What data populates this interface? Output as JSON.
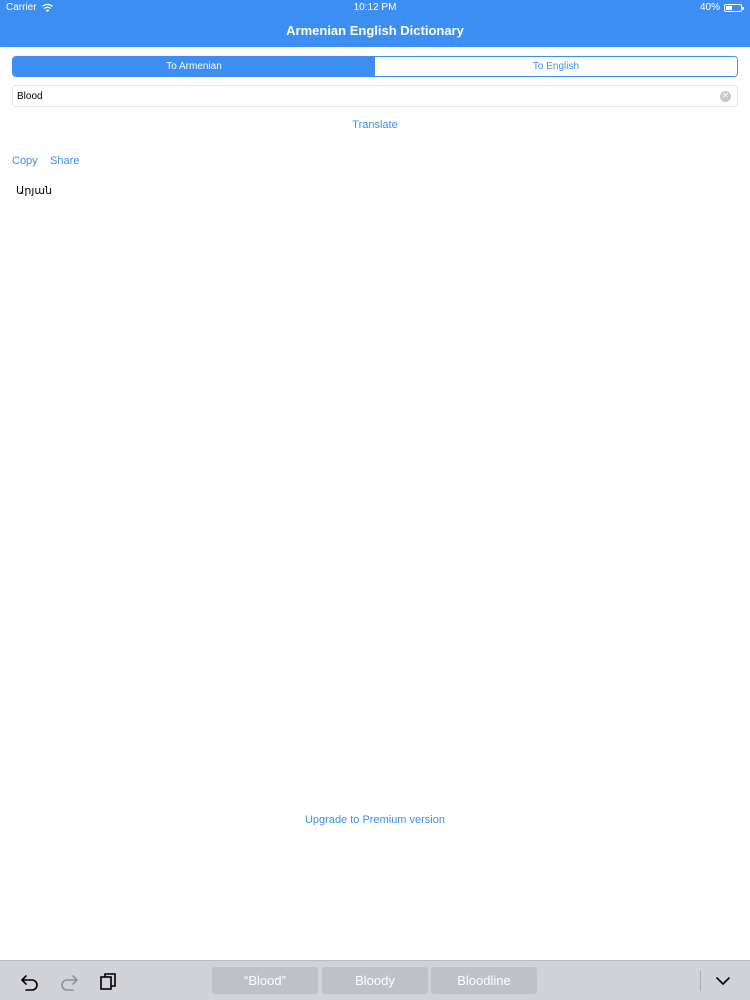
{
  "status_bar": {
    "carrier": "Carrier",
    "time": "10:12 PM",
    "battery_percent": "40%",
    "battery_level": 0.4
  },
  "nav": {
    "title": "Armenian English Dictionary"
  },
  "segments": [
    {
      "label": "To Armenian",
      "active": true
    },
    {
      "label": "To English",
      "active": false
    }
  ],
  "search": {
    "value": "Blood"
  },
  "translate_label": "Translate",
  "actions": {
    "copy": "Copy",
    "share": "Share"
  },
  "result": "Արյան",
  "upgrade_label": "Upgrade to Premium version",
  "keyboard": {
    "suggestions": [
      "“Blood”",
      "Bloody",
      "Bloodline"
    ]
  },
  "colors": {
    "accent": "#3c8ef3",
    "keyboard_bar": "#d1d3d8",
    "suggestion_bg": "#bec1c8"
  }
}
